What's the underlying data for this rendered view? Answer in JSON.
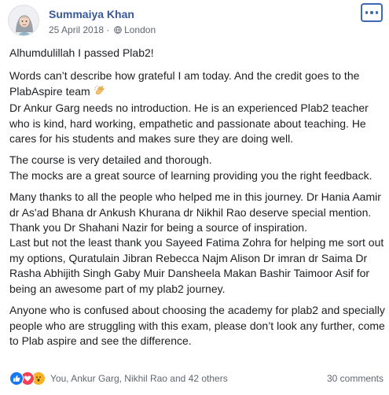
{
  "post": {
    "author": "Summaiya Khan",
    "date": "25 April 2018",
    "separator": " · ",
    "location": "London",
    "paragraphs": [
      "Alhumdulillah I passed Plab2!",
      "Words can’t describe how grateful I am today. And the credit goes to the PlabAspire team",
      "Dr Ankur Garg needs no introduction. He is an experienced Plab2 teacher who is kind, hard working, empathetic and passionate about teaching. He cares for his students and makes sure they are doing well.",
      "The course is very detailed and thorough.\nThe mocks are a great source of learning providing you the right feedback.",
      "Many thanks to all the people who helped me in this journey. Dr Hania Aamir dr As'ad Bhana dr Ankush Khurana dr Nikhil Rao deserve special mention.\nThank you Dr Shahani Nazir for being a source of inspiration.\nLast but not the least thank you Sayeed Fatima Zohra for helping me sort out my options, Quratulain Jibran Rebecca Najm Alison Dr imran dr Saima Dr Rasha Abhijith Singh Gaby Muir Dansheela Makan Bashir Taimoor Asif for being an awesome part of my plab2 journey.",
      "Anyone who is confused about choosing the academy for plab2 and specially people who are struggling with this exam, please don’t look any further, come to Plab aspire and see the difference."
    ]
  },
  "footer": {
    "reactions": [
      "like",
      "love",
      "wow"
    ],
    "reactors": "You, Ankur Garg, Nikhil Rao and 42 others",
    "comments": "30 comments"
  },
  "icons": {
    "more": "more-options-icon",
    "globe": "globe-icon",
    "clap": "clapping-hands-emoji"
  },
  "colors": {
    "author": "#385898",
    "accent": "#4267b2",
    "meta": "#616770",
    "like": "#1877f2",
    "love": "#f33e58",
    "wow": "#f7b125"
  }
}
